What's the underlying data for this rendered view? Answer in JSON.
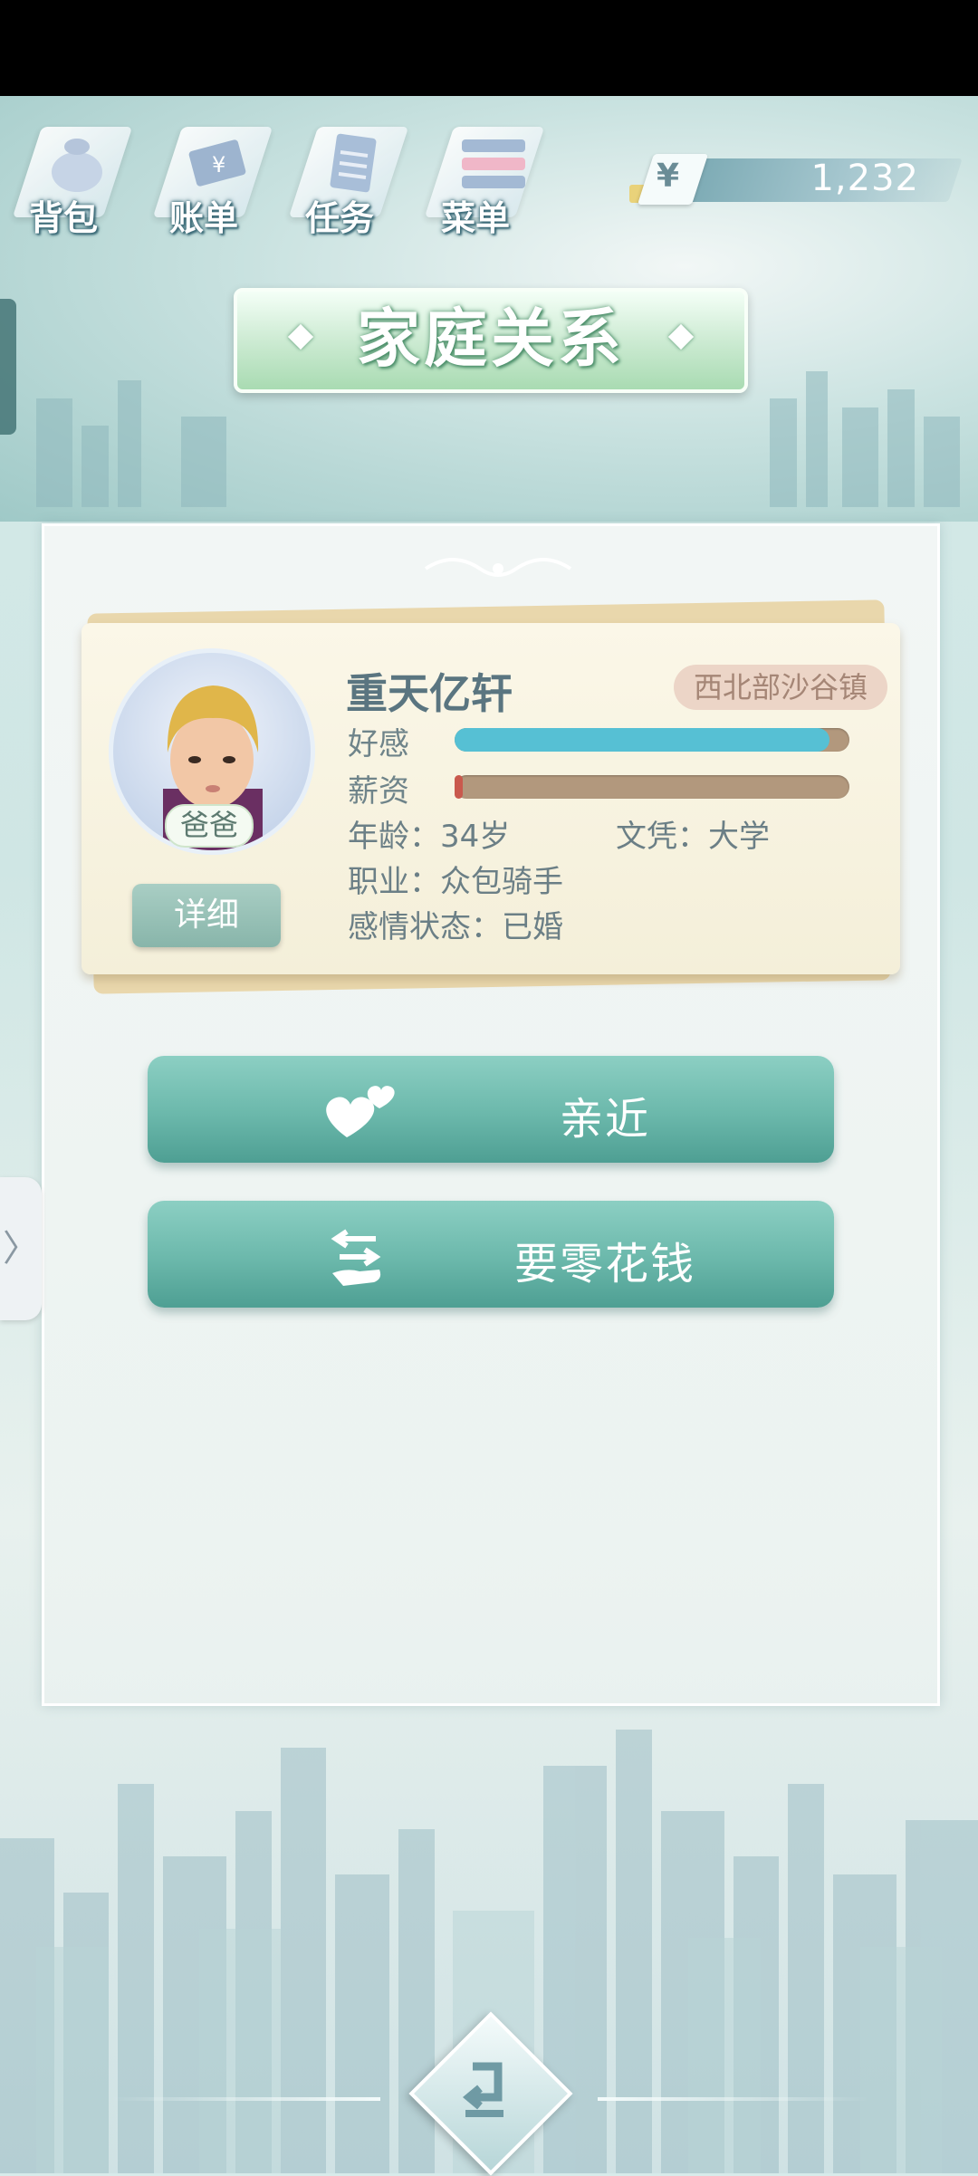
{
  "top_menu": {
    "items": [
      {
        "label": "背包",
        "icon": "bag-icon"
      },
      {
        "label": "账单",
        "icon": "bill-icon"
      },
      {
        "label": "任务",
        "icon": "task-icon"
      },
      {
        "label": "菜单",
        "icon": "menu-icon"
      }
    ]
  },
  "currency": {
    "symbol": "¥",
    "amount": "1,232"
  },
  "page": {
    "title": "家庭关系"
  },
  "member": {
    "relation": "爸爸",
    "name": "重天亿轩",
    "location": "西北部沙谷镇",
    "affection_label": "好感",
    "affection_level": 0.95,
    "salary_label": "薪资",
    "salary_level": 0.01,
    "age": "年龄：34岁",
    "education": "文凭：大学",
    "job": "职业：众包骑手",
    "marital": "感情状态：已婚",
    "detail_button": "详细"
  },
  "actions": {
    "get_close": "亲近",
    "ask_money": "要零花钱"
  },
  "side_tab": {
    "arrow": "〉"
  },
  "colors": {
    "affection": "#56c0d4",
    "salary": "#c9594d",
    "action_button": "#6bb8ab"
  }
}
